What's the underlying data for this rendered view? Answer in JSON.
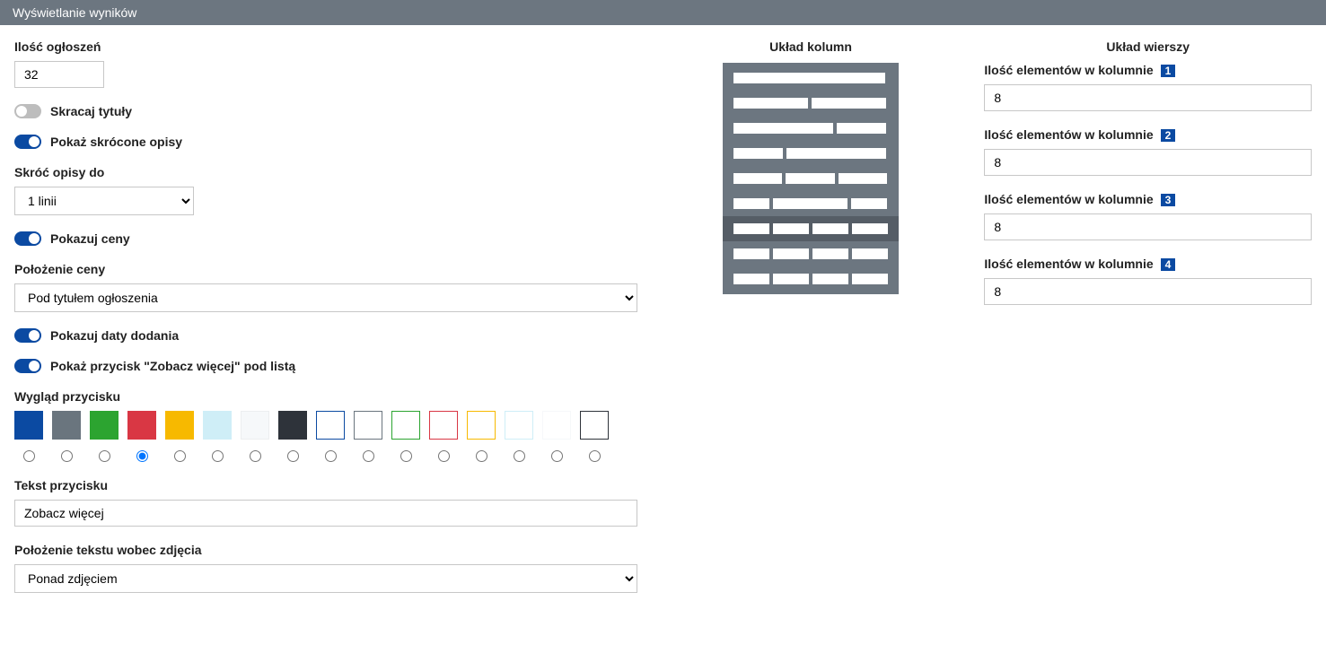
{
  "header": {
    "title": "Wyświetlanie wyników"
  },
  "left": {
    "countLabel": "Ilość ogłoszeń",
    "countValue": "32",
    "shortenTitlesLabel": "Skracaj tytuły",
    "shortenTitlesOn": false,
    "showShortDescLabel": "Pokaż skrócone opisy",
    "showShortDescOn": true,
    "shortenDescToLabel": "Skróć opisy do",
    "shortenDescToValue": "1 linii",
    "showPricesLabel": "Pokazuj ceny",
    "showPricesOn": true,
    "pricePosLabel": "Położenie ceny",
    "pricePosValue": "Pod tytułem ogłoszenia",
    "showDatesLabel": "Pokazuj daty dodania",
    "showDatesOn": true,
    "showMoreBtnLabel": "Pokaż przycisk \"Zobacz więcej\" pod listą",
    "showMoreBtnOn": true,
    "btnLookLabel": "Wygląd przycisku",
    "swatches": [
      {
        "bg": "#0b4aa2",
        "outline": false,
        "border": "#0b4aa2"
      },
      {
        "bg": "#6a757e",
        "outline": false,
        "border": "#6a757e"
      },
      {
        "bg": "#2ca430",
        "outline": false,
        "border": "#2ca430"
      },
      {
        "bg": "#d93744",
        "outline": false,
        "border": "#d93744"
      },
      {
        "bg": "#f7b900",
        "outline": false,
        "border": "#f7b900"
      },
      {
        "bg": "#cfeef7",
        "outline": false,
        "border": "#cfeef7"
      },
      {
        "bg": "#f6f8fa",
        "outline": false,
        "border": "#eceef0"
      },
      {
        "bg": "#2e333a",
        "outline": false,
        "border": "#2e333a"
      },
      {
        "bg": "#ffffff",
        "outline": true,
        "border": "#0b4aa2"
      },
      {
        "bg": "#ffffff",
        "outline": true,
        "border": "#6a757e"
      },
      {
        "bg": "#ffffff",
        "outline": true,
        "border": "#2ca430"
      },
      {
        "bg": "#ffffff",
        "outline": true,
        "border": "#d93744"
      },
      {
        "bg": "#ffffff",
        "outline": true,
        "border": "#f7b900"
      },
      {
        "bg": "#ffffff",
        "outline": true,
        "border": "#cfeef7"
      },
      {
        "bg": "#ffffff",
        "outline": true,
        "border": "#f6f8fa"
      },
      {
        "bg": "#ffffff",
        "outline": true,
        "border": "#2e333a"
      }
    ],
    "swatchSelectedIndex": 3,
    "btnTextLabel": "Tekst przycisku",
    "btnTextValue": "Zobacz więcej",
    "textPosLabel": "Położenie tekstu wobec zdjęcia",
    "textPosValue": "Ponad zdjęciem"
  },
  "mid": {
    "title": "Układ kolumn",
    "rows": [
      {
        "widths": [
          100
        ]
      },
      {
        "widths": [
          50,
          50
        ]
      },
      {
        "widths": [
          66,
          34
        ]
      },
      {
        "widths": [
          34,
          66
        ]
      },
      {
        "widths": [
          33.3,
          33.3,
          33.3
        ]
      },
      {
        "widths": [
          25,
          50,
          25
        ]
      },
      {
        "widths": [
          25,
          25,
          25,
          25
        ]
      },
      {
        "widths": [
          25,
          25,
          25,
          25
        ]
      },
      {
        "widths": [
          25,
          25,
          25,
          25
        ]
      }
    ],
    "selectedIndex": 6
  },
  "right": {
    "title": "Układ wierszy",
    "rowLabelBase": "Ilość elementów w kolumnie",
    "rows": [
      {
        "badge": "1",
        "value": "8"
      },
      {
        "badge": "2",
        "value": "8"
      },
      {
        "badge": "3",
        "value": "8"
      },
      {
        "badge": "4",
        "value": "8"
      }
    ]
  }
}
